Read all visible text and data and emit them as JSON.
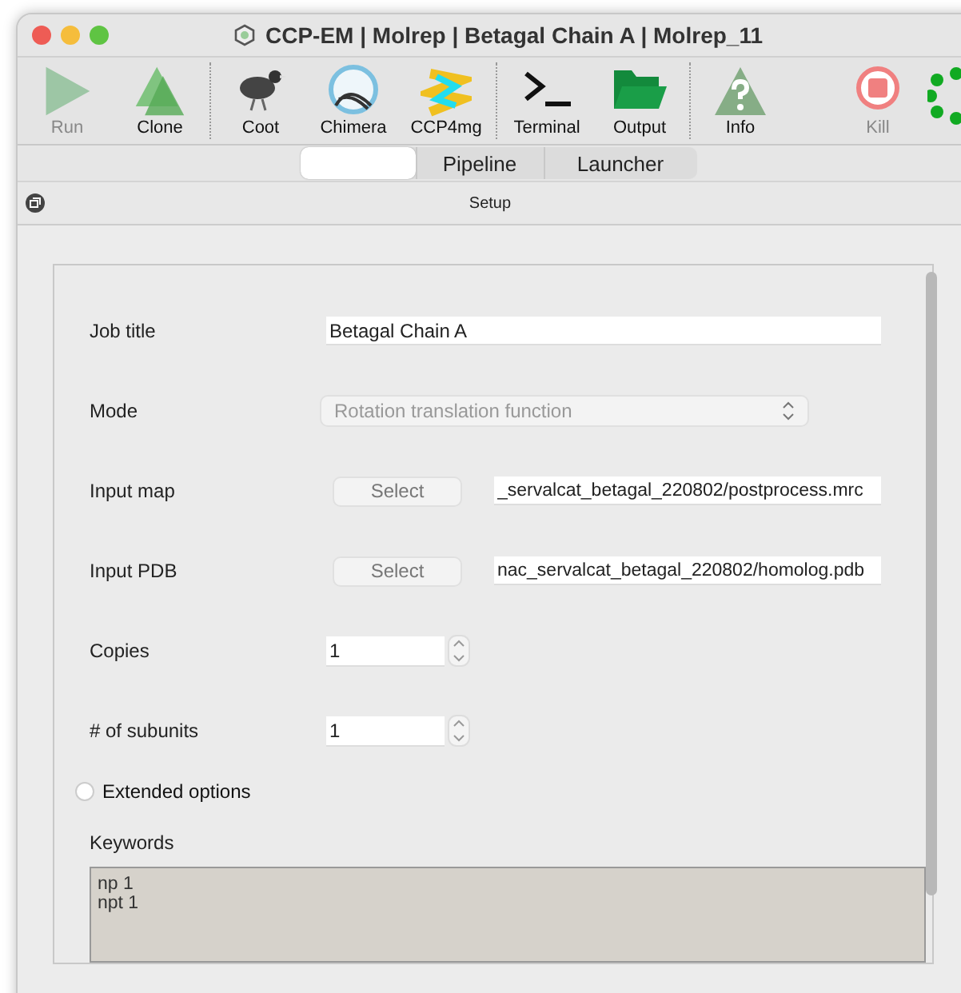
{
  "window": {
    "title": "CCP-EM | Molrep | Betagal Chain A | Molrep_11"
  },
  "toolbar": [
    {
      "label": "Run",
      "disabled": true,
      "separator_before": false
    },
    {
      "label": "Clone",
      "disabled": false,
      "separator_before": false
    },
    {
      "label": "Coot",
      "disabled": false,
      "separator_before": true
    },
    {
      "label": "Chimera",
      "disabled": false,
      "separator_before": false
    },
    {
      "label": "CCP4mg",
      "disabled": false,
      "separator_before": false
    },
    {
      "label": "Terminal",
      "disabled": false,
      "separator_before": true
    },
    {
      "label": "Output",
      "disabled": false,
      "separator_before": false
    },
    {
      "label": "Info",
      "disabled": false,
      "separator_before": true
    },
    {
      "label": "Kill",
      "disabled": true,
      "separator_before": false
    }
  ],
  "tabs": [
    {
      "selected": true
    },
    {
      "label": "Pipeline",
      "selected": false
    },
    {
      "label": "Launcher",
      "selected": false
    }
  ],
  "section": {
    "title": "Setup"
  },
  "form": [
    {
      "kind": "text",
      "label": "Job title",
      "value": "Betagal Chain A"
    },
    {
      "kind": "select",
      "label": "Mode",
      "value": "Rotation translation function",
      "disabled": true
    },
    {
      "kind": "file",
      "label": "Input map",
      "button": "Select",
      "value": "_servalcat_betagal_220802/postprocess.mrc"
    },
    {
      "kind": "file",
      "label": "Input PDB",
      "button": "Select",
      "value": "nac_servalcat_betagal_220802/homolog.pdb"
    },
    {
      "kind": "spin",
      "label": "Copies",
      "value": "1"
    },
    {
      "kind": "spin",
      "label": "# of subunits",
      "value": "1"
    }
  ],
  "extended_options": {
    "label": "Extended options",
    "checked": false
  },
  "keywords": {
    "label": "Keywords",
    "lines": [
      "np 1",
      "npt 1"
    ]
  }
}
